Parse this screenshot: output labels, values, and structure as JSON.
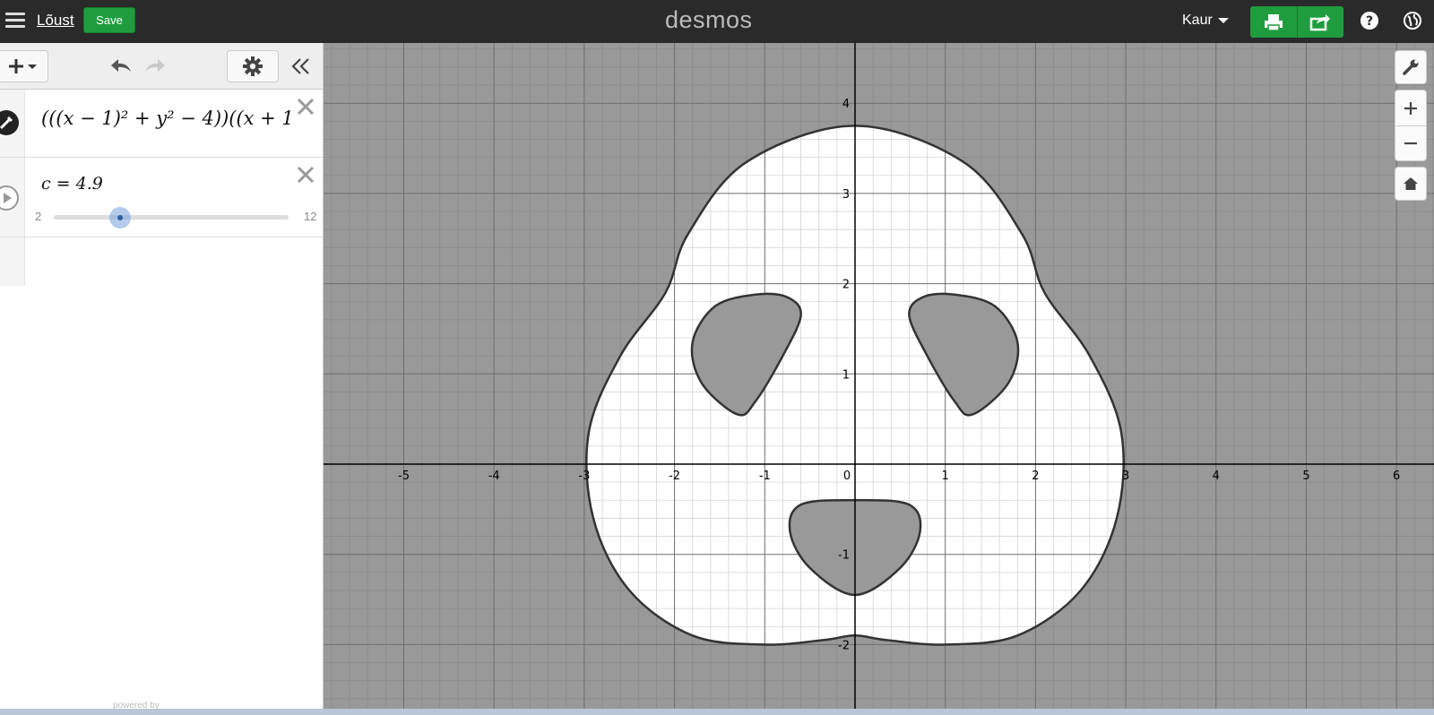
{
  "header": {
    "title": "Lõust",
    "save_label": "Save",
    "logo": "desmos",
    "user": "Kaur"
  },
  "expressions": [
    {
      "type": "implicit",
      "latex_visible": "(((x − 1)² + y² − 4))((x + 1)",
      "color": "#000000"
    },
    {
      "type": "slider",
      "variable": "c",
      "label": "c = 4.9",
      "value": 4.9,
      "min": "2",
      "max": "12"
    }
  ],
  "graph": {
    "x_ticks": [
      "-5",
      "-4",
      "-3",
      "-2",
      "-1",
      "0",
      "1",
      "2",
      "3",
      "4",
      "5",
      "6"
    ],
    "y_ticks": [
      "4",
      "3",
      "2",
      "1",
      "-1",
      "-2"
    ],
    "background": "#999999",
    "region_fill": "#ffffff",
    "curve_color": "#333333"
  },
  "footer": {
    "powered_by": "powered by"
  }
}
